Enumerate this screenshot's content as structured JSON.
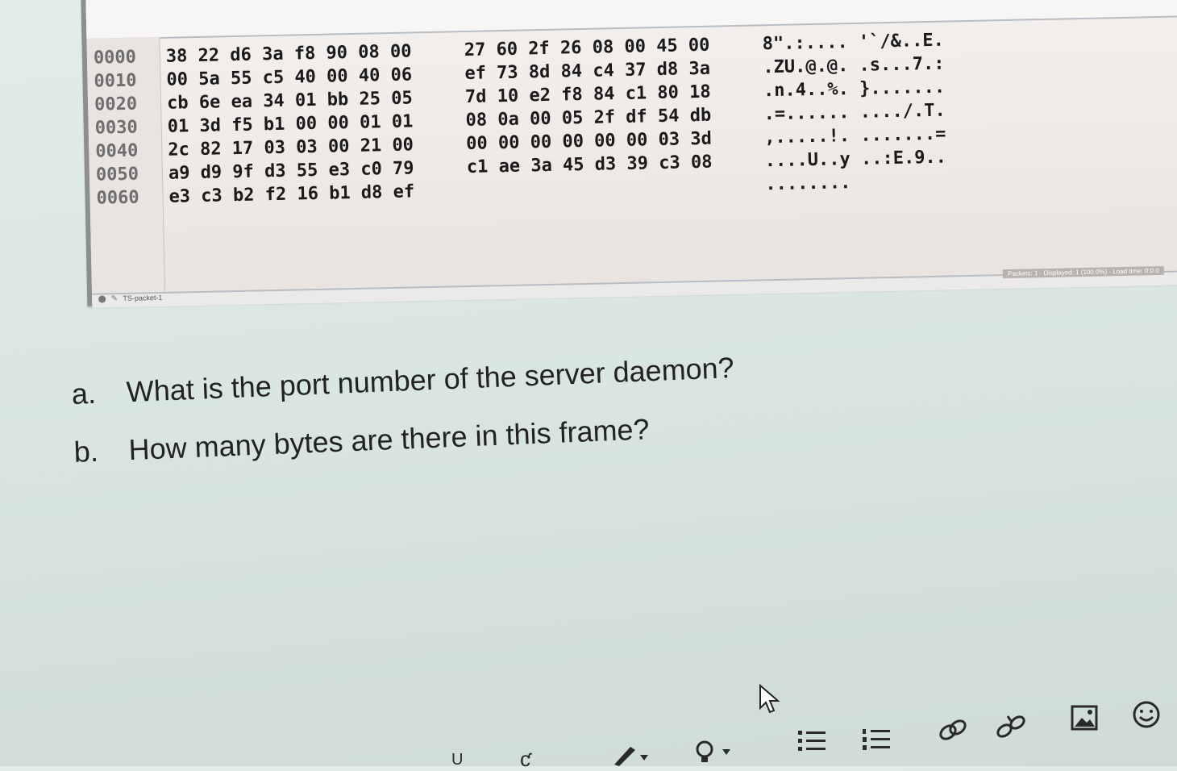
{
  "hex_dump": {
    "rows": [
      {
        "offset": "0000",
        "bytes_a": "38 22 d6 3a f8 90 08 00",
        "bytes_b": "27 60 2f 26 08 00 45 00",
        "ascii": "8\".:.... '`/&..E."
      },
      {
        "offset": "0010",
        "bytes_a": "00 5a 55 c5 40 00 40 06",
        "bytes_b": "ef 73 8d 84 c4 37 d8 3a",
        "ascii": ".ZU.@.@. .s...7.:"
      },
      {
        "offset": "0020",
        "bytes_a": "cb 6e ea 34 01 bb 25 05",
        "bytes_b": "7d 10 e2 f8 84 c1 80 18",
        "ascii": ".n.4..%. }......."
      },
      {
        "offset": "0030",
        "bytes_a": "01 3d f5 b1 00 00 01 01",
        "bytes_b": "08 0a 00 05 2f df 54 db",
        "ascii": ".=...... ..../.T."
      },
      {
        "offset": "0040",
        "bytes_a": "2c 82 17 03 03 00 21 00",
        "bytes_b": "00 00 00 00 00 00 03 3d",
        "ascii": ",.....!. .......="
      },
      {
        "offset": "0050",
        "bytes_a": "a9 d9 9f d3 55 e3 c0 79",
        "bytes_b": "c1 ae 3a 45 d3 39 c3 08",
        "ascii": "....U..y ..:E.9.."
      },
      {
        "offset": "0060",
        "bytes_a": "e3 c3 b2 f2 16 b1 d8 ef",
        "bytes_b": "",
        "ascii": "........"
      }
    ],
    "status_left": "TS-packet-1",
    "status_right": "Packets: 1 · Displayed: 1 (100.0%) · Load time: 0:0.0"
  },
  "questions": [
    {
      "letter": "a.",
      "text": "What is the port number of the server daemon?"
    },
    {
      "letter": "b.",
      "text": "How many bytes are there in this frame?"
    }
  ],
  "toolbar": {
    "icons": [
      "underline-icon",
      "strikethrough-icon",
      "pen-color-icon",
      "lightbulb-icon",
      "bullet-list-icon",
      "numbered-list-icon",
      "link-icon",
      "unlink-icon",
      "image-icon",
      "emoji-icon"
    ]
  },
  "colors": {
    "page_bg": "#d9e6e1",
    "hex_bg": "#f1ece9",
    "text": "#222222"
  }
}
